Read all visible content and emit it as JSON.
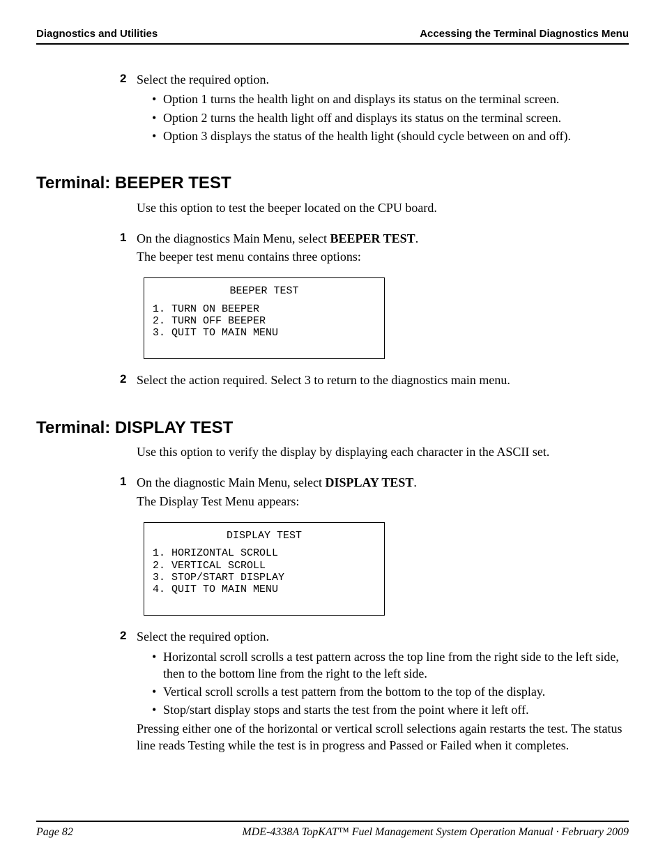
{
  "header": {
    "left": "Diagnostics and Utilities",
    "right": "Accessing the Terminal Diagnostics Menu"
  },
  "intro_step": {
    "num": "2",
    "lead": "Select the required option.",
    "bullets": [
      "Option 1 turns the health light on and displays its status on the terminal screen.",
      "Option 2 turns the health light off and displays its status on the terminal screen.",
      "Option 3 displays the status of the health light (should cycle between on and off)."
    ]
  },
  "beeper": {
    "heading": "Terminal: BEEPER TEST",
    "intro": "Use this option to test the beeper located on the CPU board.",
    "step1": {
      "num": "1",
      "pre": "On the diagnostics Main Menu, select ",
      "bold": "BEEPER TEST",
      "post": ".",
      "follow": "The beeper test menu contains three options:"
    },
    "terminal": {
      "title": "BEEPER TEST",
      "lines": "1. TURN ON BEEPER\n2. TURN OFF BEEPER\n3. QUIT TO MAIN MENU"
    },
    "step2": {
      "num": "2",
      "text": "Select the action required. Select 3 to return to the diagnostics main menu."
    }
  },
  "display": {
    "heading": "Terminal: DISPLAY TEST",
    "intro": "Use this option to verify the display by displaying each character in the ASCII set.",
    "step1": {
      "num": "1",
      "pre": "On the diagnostic Main Menu, select ",
      "bold": "DISPLAY TEST",
      "post": ".",
      "follow": "The Display Test Menu appears:"
    },
    "terminal": {
      "title": "DISPLAY TEST",
      "lines": "1. HORIZONTAL SCROLL\n2. VERTICAL SCROLL\n3. STOP/START DISPLAY\n4. QUIT TO MAIN MENU"
    },
    "step2": {
      "num": "2",
      "lead": "Select the required option.",
      "bullets": [
        "Horizontal scroll scrolls a test pattern across the top line from the right side to the left side, then to the bottom line from the right to the left side.",
        "Vertical scroll scrolls a test pattern from the bottom to the top of the display.",
        "Stop/start display stops and starts the test from the point where it left off."
      ],
      "tail": "Pressing either one of the horizontal or vertical scroll selections again restarts the test.  The status line reads Testing while the test is in progress and Passed or Failed when it completes."
    }
  },
  "footer": {
    "left": "Page 82",
    "right": "MDE-4338A TopKAT™ Fuel Management System Operation Manual · February 2009"
  }
}
